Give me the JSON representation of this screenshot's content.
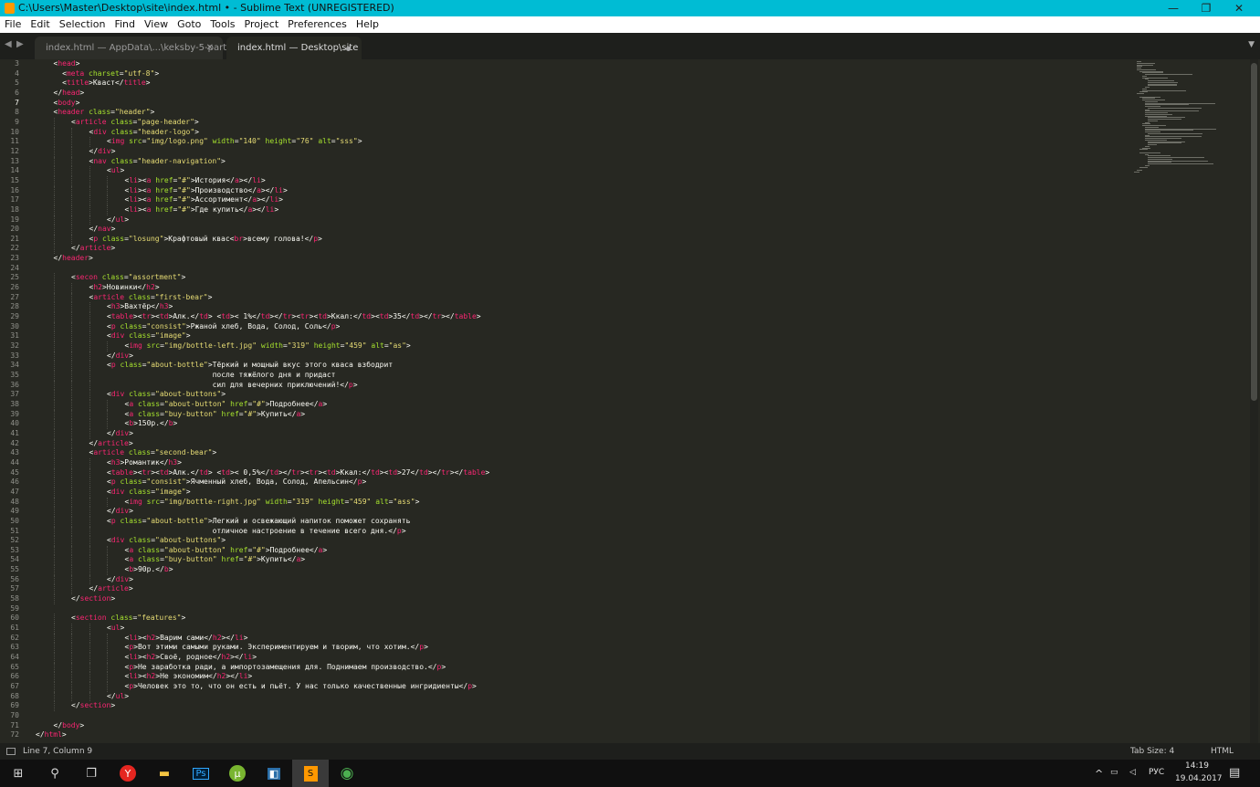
{
  "window": {
    "title": "C:\\Users\\Master\\Desktop\\site\\index.html • - Sublime Text (UNREGISTERED)",
    "minimize": "—",
    "maximize": "❐",
    "close": "✕"
  },
  "menu": [
    "File",
    "Edit",
    "Selection",
    "Find",
    "View",
    "Goto",
    "Tools",
    "Project",
    "Preferences",
    "Help"
  ],
  "tabs": [
    {
      "label": "index.html — AppData\\...\\keksby-5-part",
      "close": "✕",
      "active": false
    },
    {
      "label": "index.html — Desktop\\site",
      "active": true,
      "modified": true
    }
  ],
  "tab_nav": {
    "left": "◀",
    "right": "▶",
    "dropdown": "▼"
  },
  "editor": {
    "current_line": 7,
    "lines": [
      {
        "n": 3,
        "i": 1,
        "t": "<head>"
      },
      {
        "n": 4,
        "i": 1,
        "t": "  <meta charset=\"utf-8\">"
      },
      {
        "n": 5,
        "i": 1,
        "t": "  <title>Квaст</title>"
      },
      {
        "n": 6,
        "i": 1,
        "t": "</head>"
      },
      {
        "n": 7,
        "i": 1,
        "t": "<body>"
      },
      {
        "n": 8,
        "i": 1,
        "t": "<header class=\"header\">"
      },
      {
        "n": 9,
        "i": 2,
        "t": "<article class=\"page-header\">"
      },
      {
        "n": 10,
        "i": 3,
        "t": "<div class=\"header-logo\">"
      },
      {
        "n": 11,
        "i": 4,
        "t": "<img src=\"img/logo.png\" width=\"140\" height=\"76\" alt=\"sss\">"
      },
      {
        "n": 12,
        "i": 3,
        "t": "</div>"
      },
      {
        "n": 13,
        "i": 3,
        "t": "<nav class=\"header-navigation\">"
      },
      {
        "n": 14,
        "i": 4,
        "t": "<ul>"
      },
      {
        "n": 15,
        "i": 5,
        "t": "<li><a href=\"#\">История</a></li>"
      },
      {
        "n": 16,
        "i": 5,
        "t": "<li><a href=\"#\">Производство</a></li>"
      },
      {
        "n": 17,
        "i": 5,
        "t": "<li><a href=\"#\">Ассортимент</a></li>"
      },
      {
        "n": 18,
        "i": 5,
        "t": "<li><a href=\"#\">Где купить</a></li>"
      },
      {
        "n": 19,
        "i": 4,
        "t": "</ul>"
      },
      {
        "n": 20,
        "i": 3,
        "t": "</nav>"
      },
      {
        "n": 21,
        "i": 3,
        "t": "<p class=\"losung\">Крафтовый квас<br>всему голова!</p>"
      },
      {
        "n": 22,
        "i": 2,
        "t": "</article>"
      },
      {
        "n": 23,
        "i": 1,
        "t": "</header>"
      },
      {
        "n": 24,
        "i": 0,
        "t": ""
      },
      {
        "n": 25,
        "i": 2,
        "t": "<secon class=\"assortment\">"
      },
      {
        "n": 26,
        "i": 3,
        "t": "<h2>Новинки</h2>"
      },
      {
        "n": 27,
        "i": 3,
        "t": "<article class=\"first-bear\">"
      },
      {
        "n": 28,
        "i": 4,
        "t": "<h3>Вахтёр</h3>"
      },
      {
        "n": 29,
        "i": 4,
        "t": "<table><tr><td>Алк.</td> <td>< 1%</td></tr><tr><td>Ккал:</td><td>35</td></tr></table>"
      },
      {
        "n": 30,
        "i": 4,
        "t": "<p class=\"consist\">Ржаной хлеб, Вода, Солод, Соль</p>"
      },
      {
        "n": 31,
        "i": 4,
        "t": "<div class=\"image\">"
      },
      {
        "n": 32,
        "i": 5,
        "t": "<img src=\"img/bottle-left.jpg\" width=\"319\" height=\"459\" alt=\"as\">"
      },
      {
        "n": 33,
        "i": 4,
        "t": "</div>"
      },
      {
        "n": 34,
        "i": 4,
        "t": "<p class=\"about-bottle\">Тёркий и мощный вкус этого кваса взбодрит"
      },
      {
        "n": 35,
        "i": 4,
        "t": "                        после тяжёлого дня и придаст"
      },
      {
        "n": 36,
        "i": 4,
        "t": "                        сил для вечерних приключений!</p>"
      },
      {
        "n": 37,
        "i": 4,
        "t": "<div class=\"about-buttons\">"
      },
      {
        "n": 38,
        "i": 5,
        "t": "<a class=\"about-button\" href=\"#\">Подробнее</a>"
      },
      {
        "n": 39,
        "i": 5,
        "t": "<a class=\"buy-button\" href=\"#\">Купить</a>"
      },
      {
        "n": 40,
        "i": 5,
        "t": "<b>150р.</b>"
      },
      {
        "n": 41,
        "i": 4,
        "t": "</div>"
      },
      {
        "n": 42,
        "i": 3,
        "t": "</article>"
      },
      {
        "n": 43,
        "i": 3,
        "t": "<article class=\"second-bear\">"
      },
      {
        "n": 44,
        "i": 4,
        "t": "<h3>Романтик</h3>"
      },
      {
        "n": 45,
        "i": 4,
        "t": "<table><tr><td>Алк.</td> <td>< 0,5%</td></tr><tr><td>Ккал:</td><td>27</td></tr></table>"
      },
      {
        "n": 46,
        "i": 4,
        "t": "<p class=\"consist\">Ячменный хлеб, Вода, Солод, Апельсин</p>"
      },
      {
        "n": 47,
        "i": 4,
        "t": "<div class=\"image\">"
      },
      {
        "n": 48,
        "i": 5,
        "t": "<img src=\"img/bottle-right.jpg\" width=\"319\" height=\"459\" alt=\"ass\">"
      },
      {
        "n": 49,
        "i": 4,
        "t": "</div>"
      },
      {
        "n": 50,
        "i": 4,
        "t": "<p class=\"about-bottle\">Легкий и освежающий напиток поможет сохранять"
      },
      {
        "n": 51,
        "i": 4,
        "t": "                        отличное настроение в течение всего дня.</p>"
      },
      {
        "n": 52,
        "i": 4,
        "t": "<div class=\"about-buttons\">"
      },
      {
        "n": 53,
        "i": 5,
        "t": "<a class=\"about-button\" href=\"#\">Подробнее</a>"
      },
      {
        "n": 54,
        "i": 5,
        "t": "<a class=\"buy-button\" href=\"#\">Купить</a>"
      },
      {
        "n": 55,
        "i": 5,
        "t": "<b>90р.</b>"
      },
      {
        "n": 56,
        "i": 4,
        "t": "</div>"
      },
      {
        "n": 57,
        "i": 3,
        "t": "</article>"
      },
      {
        "n": 58,
        "i": 2,
        "t": "</section>"
      },
      {
        "n": 59,
        "i": 0,
        "t": ""
      },
      {
        "n": 60,
        "i": 2,
        "t": "<section class=\"features\">"
      },
      {
        "n": 61,
        "i": 4,
        "t": "<ul>"
      },
      {
        "n": 62,
        "i": 5,
        "t": "<li><h2>Варим сами</h2></li>"
      },
      {
        "n": 63,
        "i": 5,
        "t": "<p>Вот этими самыми руками. Экспериментируем и творим, что хотим.</p>"
      },
      {
        "n": 64,
        "i": 5,
        "t": "<li><h2>Своё, родное</h2></li>"
      },
      {
        "n": 65,
        "i": 5,
        "t": "<p>Не заработка ради, а импортозамещения для. Поднимаем производство.</p>"
      },
      {
        "n": 66,
        "i": 5,
        "t": "<li><h2>Не экономим</h2></li>"
      },
      {
        "n": 67,
        "i": 5,
        "t": "<p>Человек это то, что он есть и пьёт. У нас только качественные ингридиенты</p>"
      },
      {
        "n": 68,
        "i": 4,
        "t": "</ul>"
      },
      {
        "n": 69,
        "i": 2,
        "t": "</section>"
      },
      {
        "n": 70,
        "i": 0,
        "t": ""
      },
      {
        "n": 71,
        "i": 1,
        "t": "</body>"
      },
      {
        "n": 72,
        "i": 0,
        "t": "</html>"
      }
    ]
  },
  "status": {
    "position": "Line 7, Column 9",
    "tab_size": "Tab Size: 4",
    "syntax": "HTML"
  },
  "taskbar": {
    "apps": [
      {
        "name": "start",
        "glyph": "⊞"
      },
      {
        "name": "search",
        "glyph": "⚲"
      },
      {
        "name": "task-view",
        "glyph": "❐"
      },
      {
        "name": "yandex-browser",
        "glyph": "Y"
      },
      {
        "name": "file-explorer",
        "glyph": "▬"
      },
      {
        "name": "photoshop",
        "glyph": "Ps"
      },
      {
        "name": "utorrent",
        "glyph": "µ"
      },
      {
        "name": "app",
        "glyph": "◧"
      },
      {
        "name": "sublime-text",
        "glyph": "S"
      },
      {
        "name": "chrome",
        "glyph": "◉"
      }
    ],
    "tray": {
      "up": "^",
      "lang": "РУС",
      "time": "14:19",
      "date": "19.04.2017",
      "notifications": "▤"
    }
  },
  "colors": {
    "tag": "#f92672",
    "attr": "#a6e22e",
    "string": "#e6db74",
    "text": "#f8f8f2",
    "bg": "#272822",
    "titlebar": "#00bcd4"
  }
}
